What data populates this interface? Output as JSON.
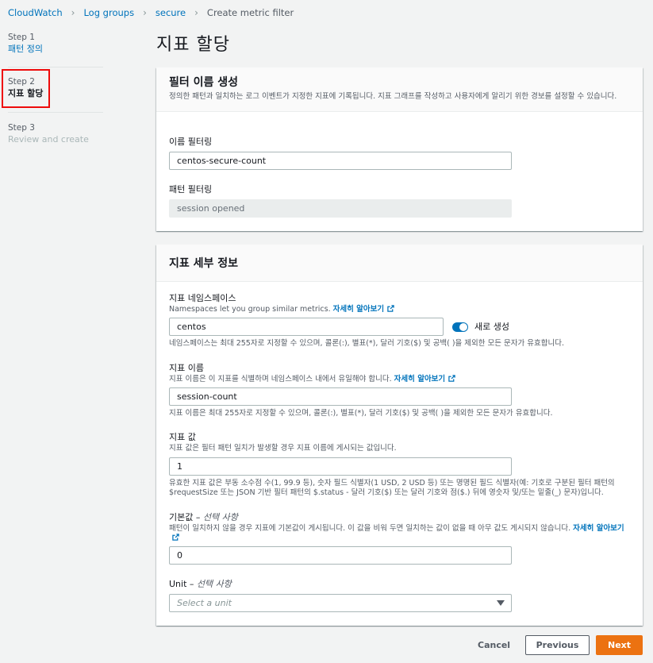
{
  "breadcrumb": {
    "items": [
      "CloudWatch",
      "Log groups",
      "secure"
    ],
    "current": "Create metric filter"
  },
  "steps": [
    {
      "num": "Step 1",
      "label": "패턴 정의"
    },
    {
      "num": "Step 2",
      "label": "지표 할당"
    },
    {
      "num": "Step 3",
      "label": "Review and create"
    }
  ],
  "page_title": "지표 할당",
  "filter_panel": {
    "title": "필터 이름 생성",
    "description": "정의한 패턴과 일치하는 로그 이벤트가 지정한 지표에 기록됩니다. 지표 그래프를 작성하고 사용자에게 알리기 위한 경보를 설정할 수 있습니다.",
    "name_label": "이름 필터링",
    "name_value": "centos-secure-count",
    "pattern_label": "패턴 필터링",
    "pattern_value": "session opened"
  },
  "metric_panel": {
    "title": "지표 세부 정보",
    "namespace": {
      "label": "지표 네임스페이스",
      "desc": "Namespaces let you group similar metrics.",
      "learn_more": "자세히 알아보기",
      "value": "centos",
      "toggle_label": "새로 생성",
      "constraint": "네임스페이스는 최대 255자로 지정할 수 있으며, 콜론(:), 별표(*), 달러 기호($) 및 공백( )을 제외한 모든 문자가 유효합니다."
    },
    "metric_name": {
      "label": "지표 이름",
      "desc": "지표 이름은 이 지표를 식별하며 네임스페이스 내에서 유일해야 합니다.",
      "learn_more": "자세히 알아보기",
      "value": "session-count",
      "constraint": "지표 이름은 최대 255자로 지정할 수 있으며, 콜론(:), 별표(*), 달러 기호($) 및 공백( )을 제외한 모든 문자가 유효합니다."
    },
    "metric_value": {
      "label": "지표 값",
      "desc": "지표 값은 필터 패턴 일치가 발생할 경우 지표 이름에 게시되는 값입니다.",
      "value": "1",
      "constraint": "유효한 지표 값은 부동 소수점 수(1, 99.9 등), 숫자 필드 식별자(1 USD, 2 USD 등) 또는 명명된 필드 식별자(예: 기호로 구분된 필터 패턴의 $requestSize 또는 JSON 기반 필터 패턴의 $.status - 달러 기호($) 또는 달러 기호와 점($.) 뒤에 영숫자 및/또는 밑줄(_) 문자)입니다."
    },
    "default_value": {
      "label": "기본값",
      "optional": "선택 사항",
      "desc": "패턴이 일치하지 않을 경우 지표에 기본값이 게시됩니다. 이 값을 비워 두면 일치하는 값이 없을 때 아무 값도 게시되지 않습니다.",
      "learn_more": "자세히 알아보기",
      "value": "0"
    },
    "unit": {
      "label": "Unit",
      "optional": "선택 사항",
      "placeholder": "Select a unit"
    }
  },
  "actions": {
    "cancel": "Cancel",
    "previous": "Previous",
    "next": "Next"
  },
  "colors": {
    "link": "#0073bb",
    "primary": "#ec7211",
    "highlight": "#ee0b0b"
  }
}
